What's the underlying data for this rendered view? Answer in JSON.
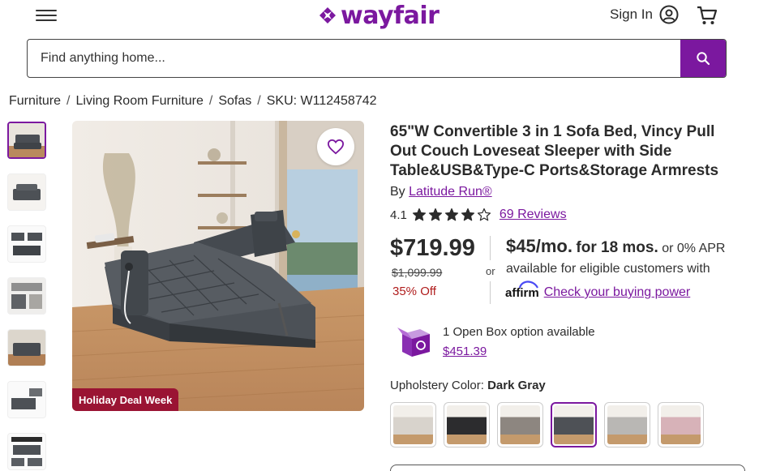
{
  "header": {
    "logo_text": "wayfair",
    "sign_in_label": "Sign In",
    "brand_color": "#7b189f"
  },
  "search": {
    "placeholder": "Find anything home..."
  },
  "breadcrumb": [
    "Furniture",
    "Living Room Furniture",
    "Sofas",
    "SKU: W112458742"
  ],
  "gallery": {
    "thumbnail_count": 7,
    "badge": "Holiday Deal Week",
    "badge_color": "#9a1433"
  },
  "product": {
    "title": "65\"W Convertible 3 in 1 Sofa Bed, Vincy Pull Out Couch Loveseat Sleeper with Side Table&USB&Type-C Ports&Storage Armrests",
    "by_label": "By",
    "brand": "Latitude Run®",
    "rating": "4.1",
    "rating_value": 4.1,
    "reviews": "69 Reviews",
    "price": "$719.99",
    "was_price": "$1,099.99",
    "discount": "35% Off",
    "or_label": "or",
    "monthly_amount": "$45/mo.",
    "monthly_term": "for 18 mos.",
    "monthly_apr": "or 0% APR",
    "eligibility": "available for eligible customers with",
    "affirm_logo": "affirm",
    "affirm_link": "Check your buying power",
    "open_box_text": "1 Open Box option available",
    "open_box_price": "$451.39",
    "upholstery_label": "Upholstery Color:",
    "upholstery_value": "Dark Gray",
    "swatches": [
      {
        "color": "#d8d3cc"
      },
      {
        "color": "#2c2c2e"
      },
      {
        "color": "#8d8680"
      },
      {
        "color": "#4e5156"
      },
      {
        "color": "#b9b7b4"
      },
      {
        "color": "#d7b2b8"
      }
    ],
    "selected_swatch": 3
  }
}
